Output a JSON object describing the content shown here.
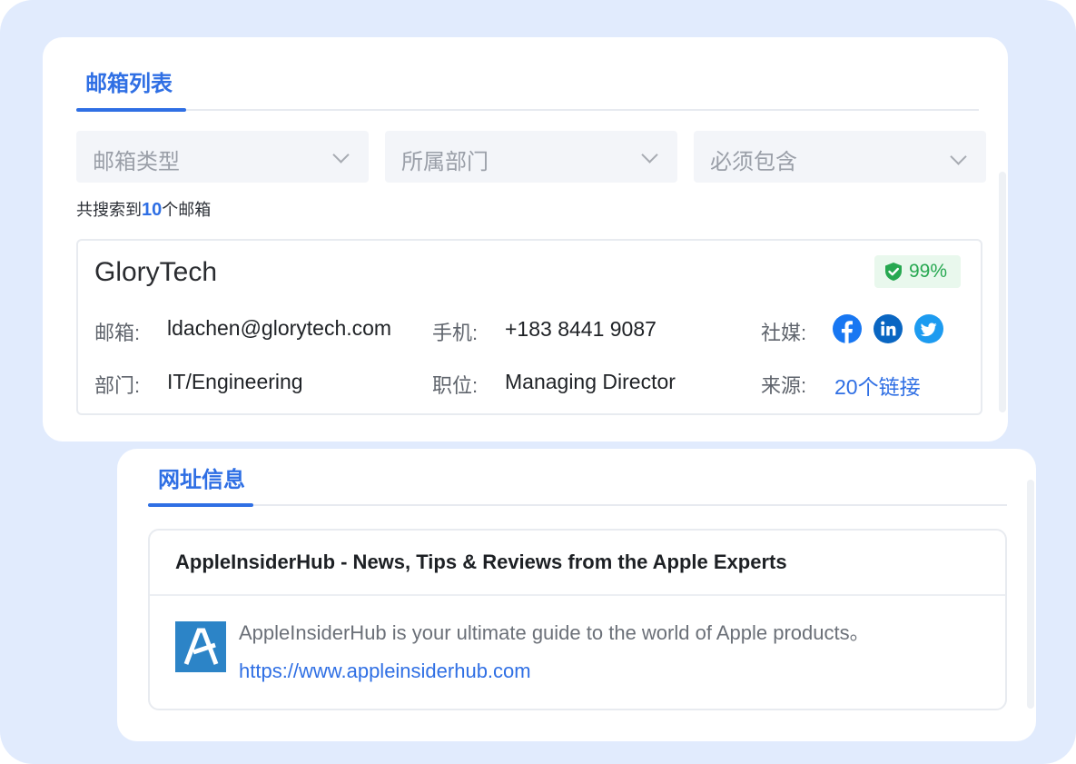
{
  "email_panel": {
    "tab_label": "邮箱列表",
    "filters": [
      {
        "placeholder": "邮箱类型"
      },
      {
        "placeholder": "所属部门"
      },
      {
        "placeholder": "必须包含"
      }
    ],
    "count_prefix": "共搜索到",
    "count_value": "10",
    "count_suffix": "个邮箱",
    "contact": {
      "company": "GloryTech",
      "score": "99%",
      "email_label": "邮箱:",
      "email_value": "ldachen@glorytech.com",
      "phone_label": "手机:",
      "phone_value": "+183 8441 9087",
      "social_label": "社媒:",
      "social_icons": [
        "facebook-icon",
        "linkedin-icon",
        "twitter-icon"
      ],
      "dept_label": "部门:",
      "dept_value": "IT/Engineering",
      "position_label": "职位:",
      "position_value": "Managing Director",
      "source_label": "来源:",
      "source_value": "20个链接"
    }
  },
  "web_panel": {
    "tab_label": "网址信息",
    "site": {
      "title": "AppleInsiderHub - News, Tips & Reviews from the Apple Experts",
      "description": "AppleInsiderHub is your ultimate guide to the world of Apple products。",
      "url": "https://www.appleinsiderhub.com"
    }
  },
  "colors": {
    "accent": "#2f6fe4",
    "background": "#e1ebfd",
    "badge_green": "#27a851",
    "facebook": "#1877f2",
    "linkedin": "#0a66c2",
    "twitter": "#1d9bf0",
    "site_logo": "#2c84c7"
  }
}
